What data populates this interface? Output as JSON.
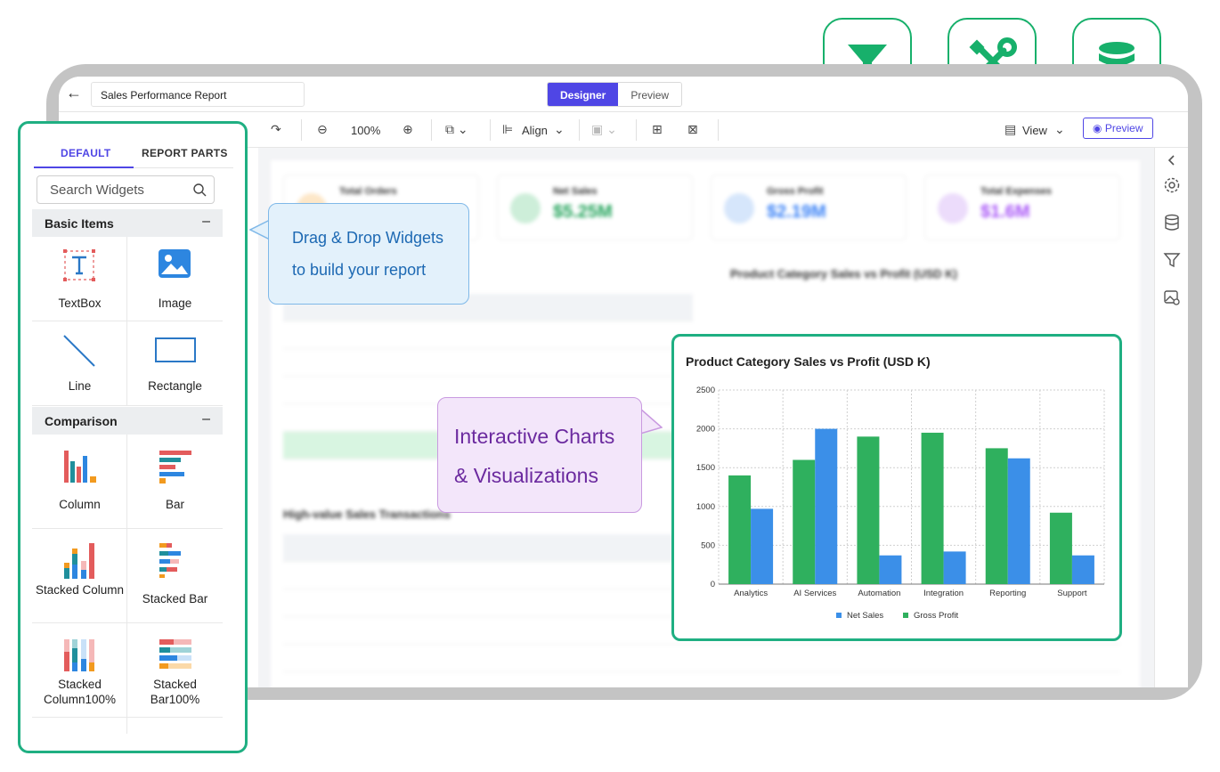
{
  "app": {
    "report_title": "Sales Performance Report",
    "mode_designer": "Designer",
    "mode_preview": "Preview"
  },
  "toolbar": {
    "zoom": "100%",
    "align_label": "Align",
    "view_label": "View",
    "preview_label": "Preview"
  },
  "widget_panel": {
    "tabs": [
      "DEFAULT",
      "REPORT PARTS"
    ],
    "active_tab": "DEFAULT",
    "search_placeholder": "Search Widgets",
    "sections": [
      {
        "name": "Basic Items",
        "items": [
          "TextBox",
          "Image",
          "Line",
          "Rectangle"
        ]
      },
      {
        "name": "Comparison",
        "items": [
          "Column",
          "Bar",
          "Stacked Column",
          "Stacked Bar",
          "Stacked Column100%",
          "Stacked Bar100%"
        ]
      }
    ]
  },
  "callouts": {
    "drag_drop": [
      "Drag & Drop Widgets",
      "to build your report"
    ],
    "charts": [
      "Interactive Charts",
      "& Visualizations"
    ]
  },
  "feature_icons": [
    "filter-icon",
    "tools-icon",
    "database-icon"
  ],
  "background_kpis": [
    {
      "label": "Total Orders",
      "value": "",
      "color": "#f59e0b"
    },
    {
      "label": "Net Sales",
      "value": "$5.25M",
      "color": "#22a35a"
    },
    {
      "label": "Gross Profit",
      "value": "$2.19M",
      "color": "#3b82f6"
    },
    {
      "label": "Total Expenses",
      "value": "$1.6M",
      "color": "#a855f7"
    }
  ],
  "background_headings": [
    "Product Category Sales vs Profit (USD K)",
    "High-value Sales Transactions"
  ],
  "colors": {
    "accent": "#4f46e5",
    "panel_border": "#1faf82",
    "net_sales": "#3b8fe8",
    "gross_profit": "#2fb05e"
  },
  "chart_data": {
    "type": "bar",
    "title": "Product Category Sales vs Profit (USD K)",
    "categories": [
      "Analytics",
      "AI Services",
      "Automation",
      "Integration",
      "Reporting",
      "Support"
    ],
    "series": [
      {
        "name": "Net Sales",
        "values": [
          970,
          2000,
          370,
          420,
          1620,
          370
        ]
      },
      {
        "name": "Gross Profit",
        "values": [
          1400,
          1600,
          1900,
          1950,
          1750,
          920
        ]
      }
    ],
    "ylim": [
      0,
      2500
    ],
    "yticks": [
      "0",
      "500",
      "1000",
      "1500",
      "2000",
      "2500"
    ],
    "legend": "bottom",
    "grid": true
  }
}
